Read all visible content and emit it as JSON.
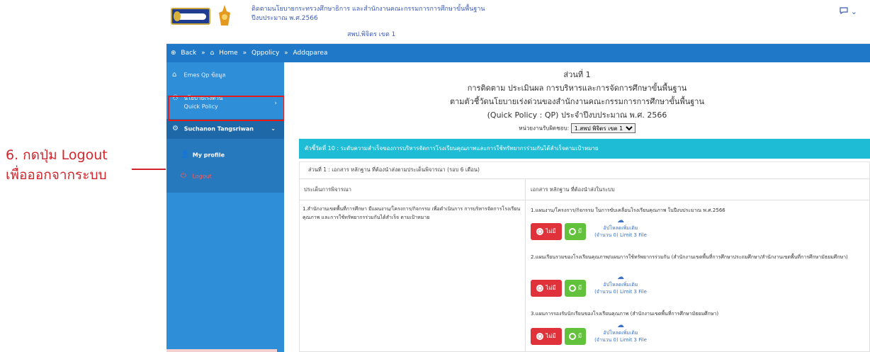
{
  "annotation": {
    "line1": "6. กดปุ่ม Logout",
    "line2": "เพื่อออกจากระบบ"
  },
  "header": {
    "title_line1": "ติดตามนโยบายกระทรวงศึกษาธิการ และสำนักงานคณะกรรมการการศึกษาขั้นพื้นฐาน",
    "title_line2": "ปีงบประมาณ พ.ศ.2566",
    "office": "สพป.พิจิตร เขต 1"
  },
  "breadcrumb": {
    "back": "Back",
    "home": "Home",
    "qppolicy": "Qppolicy",
    "current": "Addqparea"
  },
  "sidebar": {
    "home_label": "Emes Qp ข้อมูล",
    "policy_label_th": "นโยบายเร่งด่วน",
    "policy_label_en": "Quick Policy",
    "user_name": "Suchanon Tangsriwan",
    "profile_label": "My profile",
    "logout_label": "Logout"
  },
  "main": {
    "section": "ส่วนที่ 1",
    "heading1": "การติดตาม ประเมินผล การบริหารและการจัดการศึกษาขั้นพื้นฐาน",
    "heading2": "ตามตัวชี้วัดนโยบายเร่งด่วนของสำนักงานคณะกรรมการการศึกษาขั้นพื้นฐาน",
    "heading3": "(Quick Policy : QP) ประจำปีงบประมาณ พ.ศ. 2566",
    "unit_label": "หน่วยงานรับผิดชอบ:",
    "unit_value": "1.สพป พิจิตร เขต 1",
    "indicator": "ตัวชี้วัดที่ 10 : ระดับความสำเร็จของการบริหารจัดการโรงเรียนคุณภาพและการใช้ทรัพยากรร่วมกันได้สำเร็จตามเป้าหมาย",
    "part": "ส่วนที่ 1 : เอกสาร หลักฐาน ที่ต้องนำส่งตามประเด็นพิจารณา (รอบ 6 เดือน)",
    "col_left": "ประเด็นการพิจารณา",
    "col_right": "เอกสาร หลักฐาน ที่ต้องนำส่งในระบบ",
    "consider_text": "1.สำนักงานเขตพื้นที่การศึกษา มีแผนงาน/โครงการ/กิจกรรม เพื่อดำเนินการ การบริหารจัดการโรงเรียนคุณภาพ และการใช้ทรัพยากรร่วมกันได้สำเร็จ ตามเป้าหมาย",
    "docs": [
      {
        "text": "1.แผนงาน/โครงการ/กิจกรรม ในการขับเคลื่อนโรงเรียนคุณภาพ ในปีงบประมาณ พ.ศ.2566"
      },
      {
        "text": "2.แผนเรียนรวมของโรงเรียนคุณภาพ/แผนการใช้ทรัพยากรร่วมกัน (สำนักงานเขตพื้นที่การศึกษาประถมศึกษา/สำนักงานเขตพื้นที่การศึกษามัธยมศึกษา)"
      },
      {
        "text": "3.แผนการรองรับนักเรียนของโรงเรียนคุณภาพ (สำนักงานเขตพื้นที่การศึกษามัธยมศึกษา)"
      }
    ],
    "choice_have": "ไม่มี",
    "choice_none": "มี",
    "upload_label": "อัปโหลดเพิ่มเติม",
    "upload_limit": "(จำนวน 0) Limit 3 File"
  },
  "colors": {
    "sidebar": "#2e8ed8",
    "breadcrumb": "#1f78c8",
    "indicator_bar": "#1fbcd6",
    "annotation_red": "#d1252b",
    "have_red": "#e0323a",
    "none_green": "#62c23c"
  }
}
